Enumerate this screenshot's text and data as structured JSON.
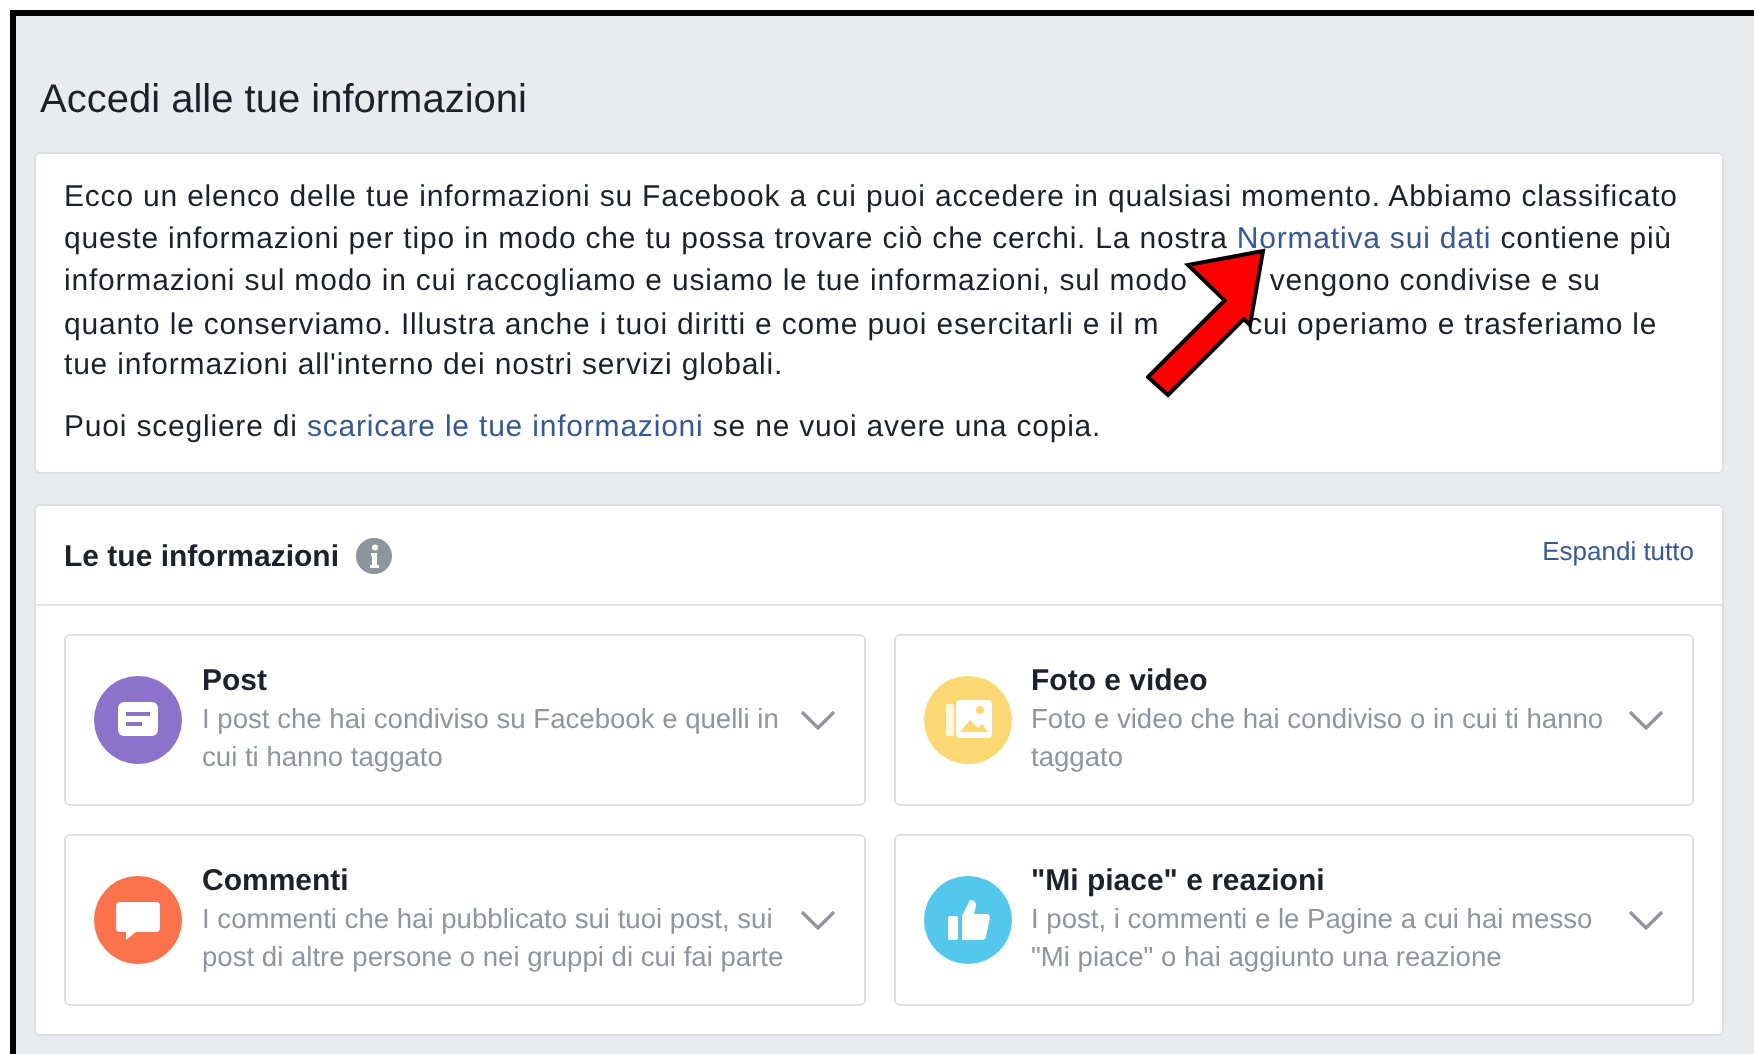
{
  "title": "Accedi alle tue informazioni",
  "intro": [
    [
      {
        "kind": "text",
        "text": "Ecco un elenco delle tue informazioni su Facebook a cui puoi accedere in qualsiasi momento. Abbiamo classificato queste informazioni per tipo in modo che tu possa trovare ciò che cerchi. La nostra "
      },
      {
        "kind": "link",
        "text": "Normativa sui dati"
      },
      {
        "kind": "text",
        "text": " contiene più informazioni sul modo in cui raccogliamo e usiamo le tue informazioni, sul modo"
      },
      {
        "kind": "covered"
      },
      {
        "kind": "text",
        "text": "vengono condivise e su quanto le conserviamo. Illustra anche i tuoi diritti e come puoi esercitarli e il m"
      },
      {
        "kind": "covered"
      },
      {
        "kind": "text",
        "text": "cui operiamo e trasferiamo le tue informazioni all'interno dei nostri servizi globali."
      }
    ],
    [
      {
        "kind": "text",
        "text": "Puoi scegliere di "
      },
      {
        "kind": "link",
        "text": "scaricare le tue informazioni"
      },
      {
        "kind": "text",
        "text": " se ne vuoi avere una copia."
      }
    ]
  ],
  "section": {
    "title": "Le tue informazioni",
    "action": "Espandi tutto"
  },
  "cards": [
    {
      "kind": "post",
      "color": "#8c72cb",
      "title": "Post",
      "description": "I post che hai condiviso su Facebook e quelli in cui ti hanno taggato"
    },
    {
      "kind": "photo",
      "color": "#fcd872",
      "title": "Foto e video",
      "description": "Foto e video che hai condiviso o in cui ti hanno taggato"
    },
    {
      "kind": "comment",
      "color": "#fb724b",
      "title": "Commenti",
      "description": "I commenti che hai pubblicato sui tuoi post, sui post di altre persone o nei gruppi di cui fai parte"
    },
    {
      "kind": "like",
      "color": "#54c7ec",
      "title": "\"Mi piace\" e reazioni",
      "description": "I post, i commenti e le Pagine a cui hai messo \"Mi piace\" o hai aggiunto una reazione"
    }
  ]
}
